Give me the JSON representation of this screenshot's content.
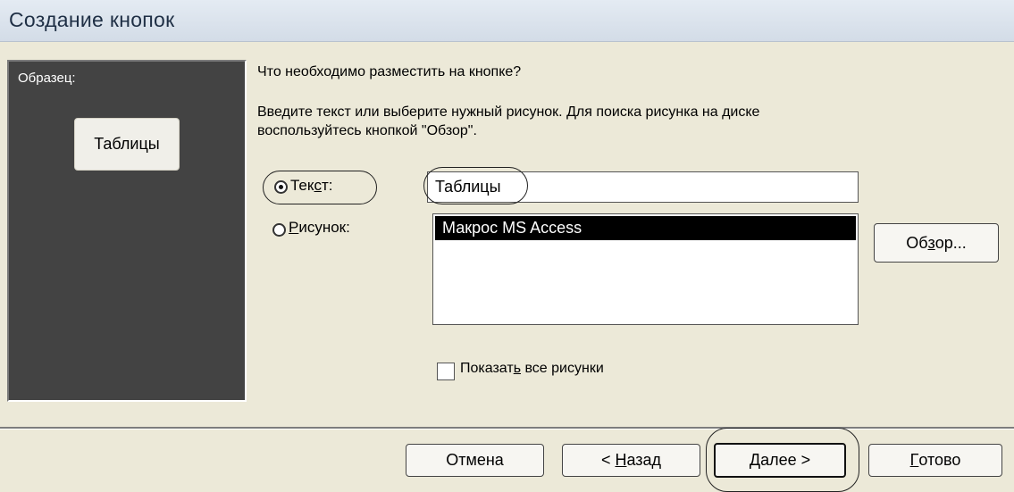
{
  "window": {
    "title": "Создание кнопок"
  },
  "preview": {
    "label": "Образец:",
    "button_label": "Таблицы"
  },
  "question": "Что необходимо разместить на кнопке?",
  "instructions_line1": "Введите текст или выберите нужный рисунок.  Для поиска рисунка на диске",
  "instructions_line2": "воспользуйтесь кнопкой \"Обзор\".",
  "text_option": {
    "label_a": "Тек",
    "label_mnemonic": "с",
    "label_b": "т:",
    "selected": true
  },
  "text_input": {
    "value": "Таблицы"
  },
  "picture_option": {
    "label_mnemonic": "Р",
    "label_b": "исунок:",
    "selected": false
  },
  "picture_list": {
    "selected_item": "Макрос MS Access"
  },
  "browse_button": {
    "label_a": "Об",
    "label_mnemonic": "з",
    "label_b": "ор..."
  },
  "show_all": {
    "label_a": "Показат",
    "label_mnemonic": "ь",
    "label_b": " все рисунки",
    "checked": false
  },
  "buttons": {
    "cancel": "Отмена",
    "back_a": "< ",
    "back_mnemonic": "Н",
    "back_b": "азад",
    "next_mnemonic": "Д",
    "next_b": "алее >",
    "finish_mnemonic": "Г",
    "finish_b": "отово"
  },
  "colors": {
    "background": "#ece9d8",
    "preview_bg": "#434343",
    "selection": "#000000"
  }
}
